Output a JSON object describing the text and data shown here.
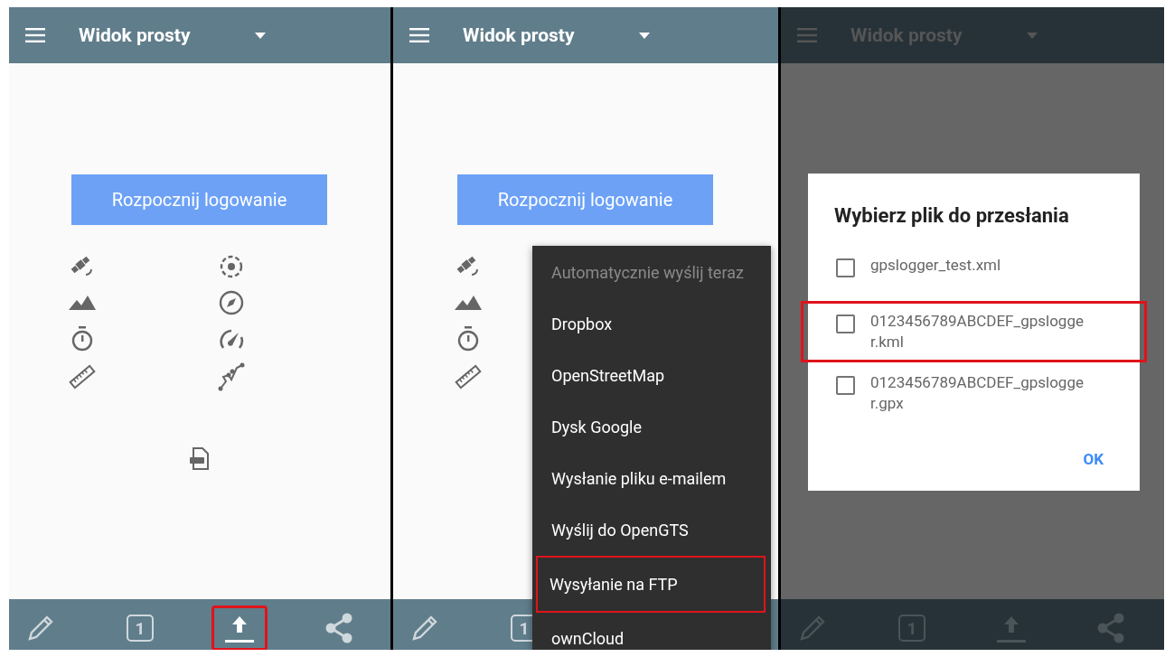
{
  "panels": [
    {
      "dimmed": false,
      "header": {
        "title": "Widok prosty"
      },
      "start_button": "Rozpocznij logowanie",
      "toolbar": [
        {
          "kind": "edit",
          "highlighted": false
        },
        {
          "kind": "counter",
          "label": "1",
          "highlighted": false
        },
        {
          "kind": "upload",
          "highlighted": true
        },
        {
          "kind": "share",
          "highlighted": false
        }
      ]
    },
    {
      "dimmed": false,
      "header": {
        "title": "Widok prosty"
      },
      "start_button": "Rozpocznij logowanie",
      "toolbar": [
        {
          "kind": "edit",
          "highlighted": false
        },
        {
          "kind": "counter",
          "label": "1",
          "highlighted": false
        }
      ],
      "menu": [
        {
          "label": "Automatycznie wyślij teraz",
          "disabled": true,
          "highlighted": false
        },
        {
          "label": "Dropbox",
          "disabled": false,
          "highlighted": false
        },
        {
          "label": "OpenStreetMap",
          "disabled": false,
          "highlighted": false
        },
        {
          "label": "Dysk Google",
          "disabled": false,
          "highlighted": false
        },
        {
          "label": "Wysłanie pliku e-mailem",
          "disabled": false,
          "highlighted": false
        },
        {
          "label": "Wyślij do OpenGTS",
          "disabled": false,
          "highlighted": false
        },
        {
          "label": "Wysyłanie na FTP",
          "disabled": false,
          "highlighted": true
        },
        {
          "label": "ownCloud",
          "disabled": false,
          "highlighted": false
        }
      ]
    },
    {
      "dimmed": true,
      "header": {
        "title": "Widok prosty"
      },
      "toolbar": [
        {
          "kind": "edit",
          "highlighted": false
        },
        {
          "kind": "counter",
          "label": "1",
          "highlighted": false
        },
        {
          "kind": "upload",
          "highlighted": false
        },
        {
          "kind": "share",
          "highlighted": false
        }
      ],
      "dialog": {
        "title": "Wybierz plik do przesłania",
        "files": [
          {
            "name": "gpslogger_test.xml",
            "checked": false,
            "highlighted": false
          },
          {
            "name": "0123456789ABCDEF_gpslogger.kml",
            "checked": false,
            "highlighted": true
          },
          {
            "name": "0123456789ABCDEF_gpslogger.gpx",
            "checked": false,
            "highlighted": false
          }
        ],
        "button": "OK"
      }
    }
  ]
}
